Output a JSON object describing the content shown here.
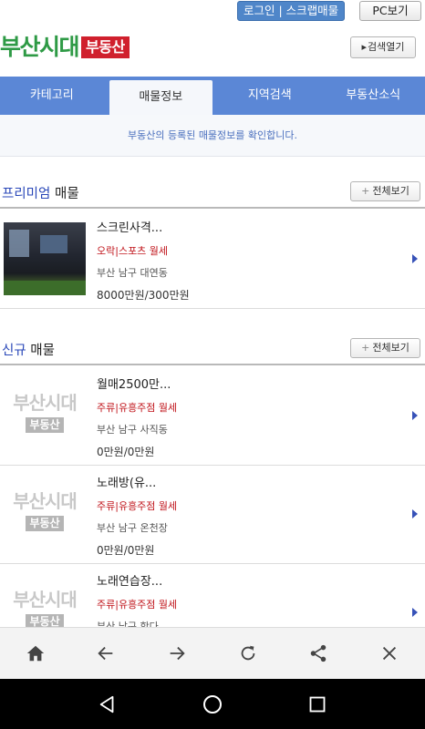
{
  "header": {
    "login_label": "로그인 | 스크랩매물",
    "pc_label": "PC보기",
    "logo_main": "부산시대",
    "logo_sub": "부동산",
    "search_open_label": "검색열기"
  },
  "nav": {
    "tabs": [
      {
        "label": "카테고리"
      },
      {
        "label": "매물정보"
      },
      {
        "label": "지역검색"
      },
      {
        "label": "부동산소식"
      }
    ],
    "active_index": 1
  },
  "notice": "부동산의 등록된 매물정보를 확인합니다.",
  "premium": {
    "title_highlight": "프리미엄",
    "title_rest": " 매물",
    "view_all_label": "전체보기",
    "items": [
      {
        "title": "스크린사격...",
        "type": "오락|스포츠 월세",
        "location": "부산 남구 대연동",
        "price": "8000만원/300만원"
      }
    ]
  },
  "new_listings": {
    "title_highlight": "신규",
    "title_rest": " 매물",
    "view_all_label": "전체보기",
    "placeholder_logo_main": "부산시대",
    "placeholder_logo_sub": "부동산",
    "items": [
      {
        "title": "월매2500만...",
        "type": "주류|유흥주점 월세",
        "location": "부산 남구 사직동",
        "price": "0만원/0만원"
      },
      {
        "title": "노래방(유...",
        "type": "주류|유흥주점 월세",
        "location": "부산 남구 온천장",
        "price": "0만원/0만원"
      },
      {
        "title": "노래연습장...",
        "type": "주류|유흥주점 월세",
        "location": "부산 남구 학다",
        "price": ""
      }
    ]
  },
  "colors": {
    "brand_green": "#2e9a45",
    "brand_red": "#d0202d",
    "nav_blue": "#5b87d6",
    "price_type_red": "#c0141b",
    "highlight_blue": "#2947b8"
  },
  "toolbar_icons": [
    "home-icon",
    "back-arrow-icon",
    "forward-arrow-icon",
    "refresh-icon",
    "share-icon",
    "close-icon"
  ],
  "system_nav_icons": [
    "system-back-icon",
    "system-home-icon",
    "system-recents-icon"
  ]
}
